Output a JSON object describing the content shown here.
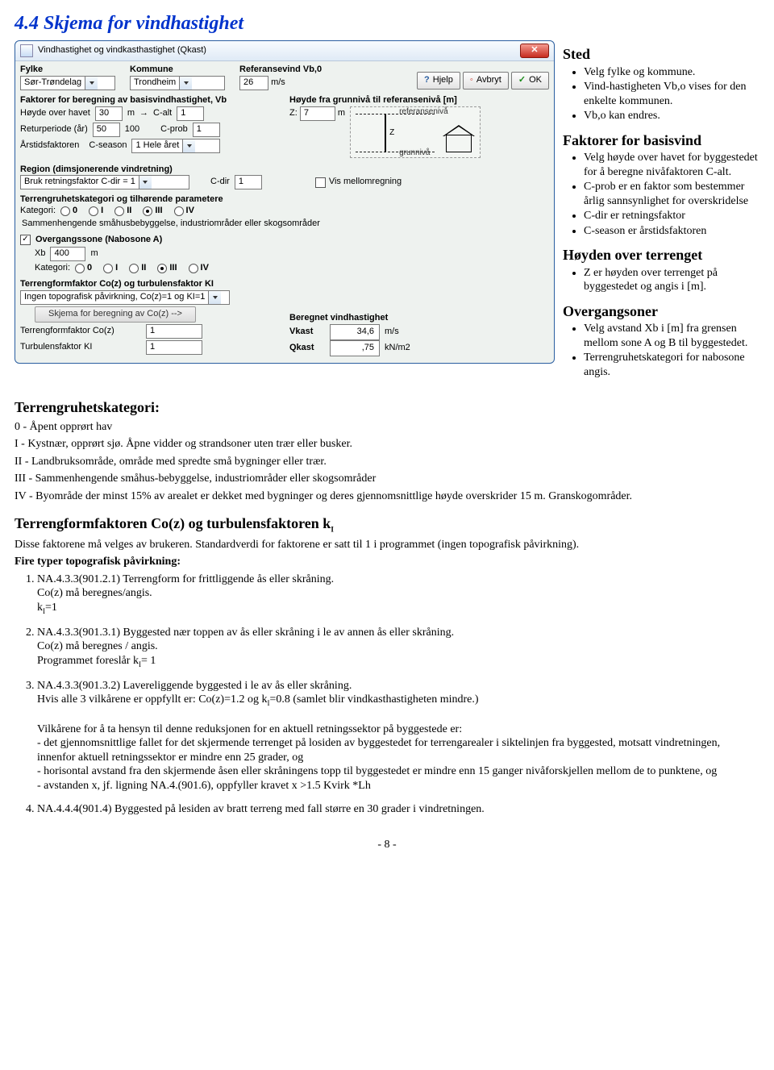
{
  "section_title": "4.4  Skjema for vindhastighet",
  "dialog": {
    "title": "Vindhastighet og vindkasthastighet (Qkast)",
    "buttons": {
      "help": "Hjelp",
      "cancel": "Avbryt",
      "ok": "OK"
    },
    "row1": {
      "fylke_lbl": "Fylke",
      "fylke_val": "Sør-Trøndelag",
      "kommune_lbl": "Kommune",
      "kommune_val": "Trondheim",
      "refvind_lbl": "Referansevind Vb,0",
      "vb0": "26",
      "vb0_unit": "m/s"
    },
    "sectionA": {
      "header": "Faktorer for beregning av basisvindhastighet, Vb",
      "hoverhavet_lbl": "Høyde over havet",
      "hoverhavet": "30",
      "hoverhavet_unit": "m",
      "arrow_lbl": "→",
      "calt_lbl": "C-alt",
      "calt": "1",
      "retur_lbl": "Returperiode (år)",
      "retur": "50",
      "retur_unit": "",
      "hund": "100",
      "cprob_lbl": "C-prob",
      "cprob": "1",
      "arstid_lbl": "Årstidsfaktoren",
      "cseason_lbl": "C-season",
      "cseason_sel": "1 Hele året"
    },
    "sectionB": {
      "header": "Høyde fra grunnivå til referansenivå [m]",
      "z_lbl": "Z:",
      "z": "7",
      "z_unit": "m",
      "diagram_top": "referansenivå",
      "diagram_bot": "grunnivå",
      "diagram_z": "Z"
    },
    "region": {
      "header": "Region (dimsjonerende vindretning)",
      "sel": "Bruk retningsfaktor C-dir = 1",
      "cdir_lbl": "C-dir",
      "cdir": "1"
    },
    "vismellom_lbl": "Vis mellomregning",
    "terr": {
      "header": "Terrengruhetskategori og tilhørende parametere",
      "kat_lbl": "Kategori:",
      "cats": [
        "0",
        "I",
        "II",
        "III",
        "IV"
      ],
      "selected1": "III",
      "desc": "Sammenhengende småhusbebyggelse, industriområder eller skogsområder"
    },
    "overgang": {
      "chk_lbl": "Overgangssone (Nabosone A)",
      "xb_lbl": "Xb",
      "xb": "400",
      "xb_unit": "m",
      "kat_lbl": "Kategori:",
      "selected2": "III"
    },
    "coz": {
      "header": "Terrengformfaktor Co(z) og turbulensfaktor KI",
      "sel": "Ingen topografisk påvirkning, Co(z)=1 og KI=1",
      "btn": "Skjema for beregning av Co(z)  -->",
      "tff_lbl": "Terrengformfaktor Co(z)",
      "tff": "1",
      "turb_lbl": "Turbulensfaktor KI",
      "turb": "1"
    },
    "result": {
      "header": "Beregnet vindhastighet",
      "vkast_lbl": "Vkast",
      "vkast": "34,6",
      "vkast_unit": "m/s",
      "qkast_lbl": "Qkast",
      "qkast": ",75",
      "qkast_unit": "kN/m2"
    }
  },
  "side": {
    "sted_h": "Sted",
    "sted": [
      "Velg fylke og kommune.",
      "Vind-hastigheten Vb,o  vises for den enkelte kommunen.",
      "Vb,o  kan endres."
    ],
    "fakt_h": "Faktorer for basisvind",
    "fakt": [
      "Velg høyde over havet for byggestedet for å beregne nivåfaktoren C-alt.",
      "C-prob er en faktor som bestemmer årlig sannsynlighet for overskridelse",
      "C-dir er retningsfaktor",
      "C-season er årstidsfaktoren"
    ],
    "hoyden_h": "Høyden over terrenget",
    "hoyden": [
      "Z er høyden over terrenget på byggestedet og angis i [m]."
    ],
    "over_h": "Overgangsoner",
    "over": [
      "Velg avstand Xb i [m] fra grensen mellom sone A og B til byggestedet.",
      "Terrengruhetskategori for nabosone angis."
    ]
  },
  "terrkat": {
    "header": "Terrengruhetskategori:",
    "items": [
      "0 - Åpent opprørt hav",
      "I - Kystnær, opprørt sjø. Åpne vidder og strandsoner uten trær eller busker.",
      "II - Landbruksområde, område med spredte små bygninger eller trær.",
      "III - Sammenhengende småhus-bebyggelse, industriområder eller skogsområder",
      "IV - Byområde der minst 15% av arealet er dekket med bygninger og deres gjennomsnittlige høyde overskrider 15 m. Granskogområder."
    ]
  },
  "tff": {
    "header": "Terrengformfaktoren Co(z) og turbulensfaktoren kI",
    "p1": "Disse faktorene må velges av brukeren.  Standardverdi for faktorene er satt til 1 i programmet (ingen topografisk påvirkning).",
    "fire_h": "Fire typer topografisk påvirkning:",
    "items": {
      "n1a": "NA.4.3.3(901.2.1) Terrengform for frittliggende ås eller skråning.",
      "n1b": "Co(z) må beregnes/angis.",
      "n1c": "kI=1",
      "n2a": "NA.4.3.3(901.3.1) Byggested nær toppen av ås eller skråning i le av annen ås eller skråning.",
      "n2b": "Co(z) må beregnes / angis.",
      "n2c": "Programmet foreslår kI= 1",
      "n3a": "NA.4.3.3(901.3.2) Lavereliggende byggested i le av ås eller skråning.",
      "n3b": "Hvis alle 3 vilkårene er oppfyllt er: Co(z)=1.2 og kI=0.8 (samlet blir vindkasthastigheten mindre.)",
      "n3c": "Vilkårene for å ta hensyn til denne reduksjonen for en aktuell retningssektor på byggestede er:",
      "n3d": "- det gjennomsnittlige fallet for det skjermende terrenget på losiden av byggestedet for terrengarealer i siktelinjen fra byggested, motsatt vindretningen, innenfor aktuell retningssektor er mindre enn 25 grader, og",
      "n3e": "- horisontal avstand fra den skjermende åsen eller skråningens topp til byggestedet er mindre enn 15 ganger nivåforskjellen mellom de to punktene, og",
      "n3f": "- avstanden x, jf. ligning NA.4.(901.6), oppfyller kravet x >1.5 Kvirk *Lh",
      "n4": "NA.4.4.4(901.4) Byggested på lesiden av bratt terreng med fall større en 30 grader i vindretningen."
    }
  },
  "footer": "- 8 -"
}
